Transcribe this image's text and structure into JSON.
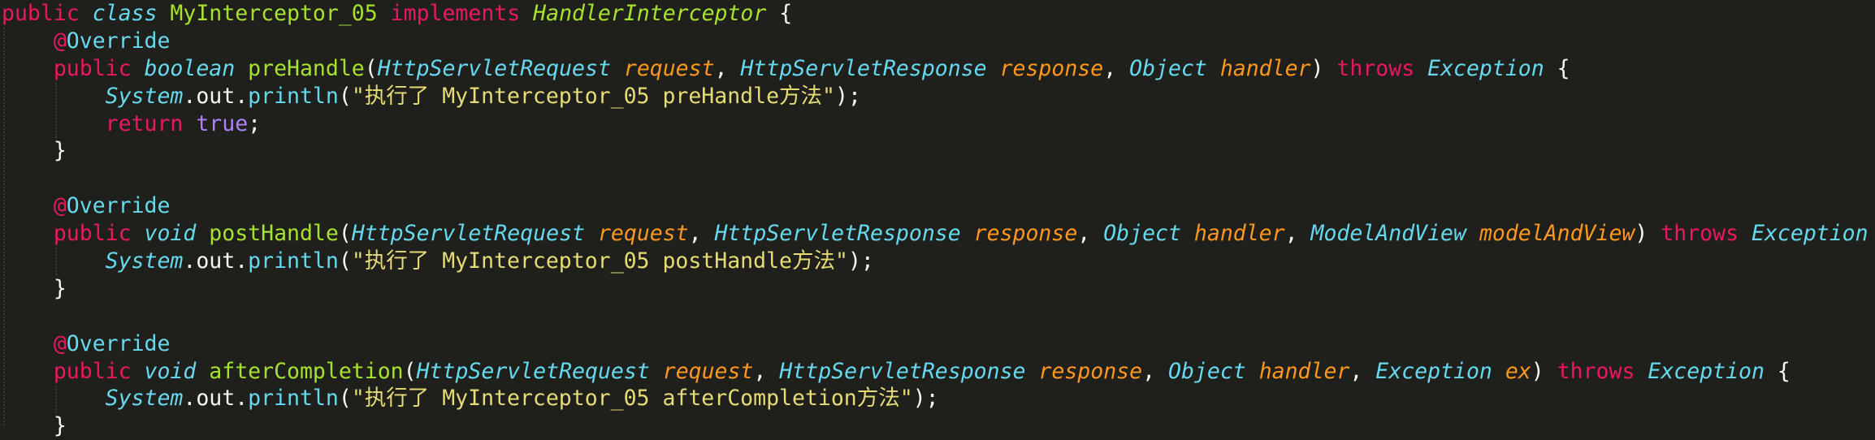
{
  "colors": {
    "background": "#1f1f1c",
    "keyword": "#e8195f",
    "type": "#66d9ef",
    "function": "#a6e22e",
    "parameter": "#fd971f",
    "string": "#e6db74",
    "constant": "#ae81ff",
    "plain": "#f8f8f2"
  },
  "lines": [
    [
      {
        "t": "public ",
        "k": "kw"
      },
      {
        "t": "class ",
        "k": "st"
      },
      {
        "t": "MyInterceptor_05 ",
        "k": "cl"
      },
      {
        "t": "implements ",
        "k": "kw"
      },
      {
        "t": "HandlerInterceptor",
        "k": "ic"
      },
      {
        "t": " {",
        "k": "pl"
      }
    ],
    [
      {
        "t": "    ",
        "k": "pl"
      },
      {
        "t": "@",
        "k": "an"
      },
      {
        "t": "Override",
        "k": "ann"
      }
    ],
    [
      {
        "t": "    ",
        "k": "pl"
      },
      {
        "t": "public ",
        "k": "kw"
      },
      {
        "t": "boolean ",
        "k": "st"
      },
      {
        "t": "preHandle",
        "k": "fn"
      },
      {
        "t": "(",
        "k": "pl"
      },
      {
        "t": "HttpServletRequest ",
        "k": "ty"
      },
      {
        "t": "request",
        "k": "pa"
      },
      {
        "t": ", ",
        "k": "pl"
      },
      {
        "t": "HttpServletResponse ",
        "k": "ty"
      },
      {
        "t": "response",
        "k": "pa"
      },
      {
        "t": ", ",
        "k": "pl"
      },
      {
        "t": "Object ",
        "k": "ty"
      },
      {
        "t": "handler",
        "k": "pa"
      },
      {
        "t": ") ",
        "k": "pl"
      },
      {
        "t": "throws ",
        "k": "kw"
      },
      {
        "t": "Exception",
        "k": "ty"
      },
      {
        "t": " {",
        "k": "pl"
      }
    ],
    [
      {
        "t": "        ",
        "k": "pl"
      },
      {
        "t": "System",
        "k": "sy"
      },
      {
        "t": ".out.",
        "k": "pl"
      },
      {
        "t": "println",
        "k": "me"
      },
      {
        "t": "(",
        "k": "pl"
      },
      {
        "t": "\"执行了 MyInterceptor_05 preHandle方法\"",
        "k": "str"
      },
      {
        "t": ");",
        "k": "pl"
      }
    ],
    [
      {
        "t": "        ",
        "k": "pl"
      },
      {
        "t": "return ",
        "k": "kw"
      },
      {
        "t": "true",
        "k": "num"
      },
      {
        "t": ";",
        "k": "pl"
      }
    ],
    [
      {
        "t": "    }",
        "k": "pl"
      }
    ],
    [],
    [
      {
        "t": "    ",
        "k": "pl"
      },
      {
        "t": "@",
        "k": "an"
      },
      {
        "t": "Override",
        "k": "ann"
      }
    ],
    [
      {
        "t": "    ",
        "k": "pl"
      },
      {
        "t": "public ",
        "k": "kw"
      },
      {
        "t": "void ",
        "k": "st"
      },
      {
        "t": "postHandle",
        "k": "fn"
      },
      {
        "t": "(",
        "k": "pl"
      },
      {
        "t": "HttpServletRequest ",
        "k": "ty"
      },
      {
        "t": "request",
        "k": "pa"
      },
      {
        "t": ", ",
        "k": "pl"
      },
      {
        "t": "HttpServletResponse ",
        "k": "ty"
      },
      {
        "t": "response",
        "k": "pa"
      },
      {
        "t": ", ",
        "k": "pl"
      },
      {
        "t": "Object ",
        "k": "ty"
      },
      {
        "t": "handler",
        "k": "pa"
      },
      {
        "t": ", ",
        "k": "pl"
      },
      {
        "t": "ModelAndView ",
        "k": "ty"
      },
      {
        "t": "modelAndView",
        "k": "pa"
      },
      {
        "t": ") ",
        "k": "pl"
      },
      {
        "t": "throws ",
        "k": "kw"
      },
      {
        "t": "Exception",
        "k": "ty"
      }
    ],
    [
      {
        "t": "        ",
        "k": "pl"
      },
      {
        "t": "System",
        "k": "sy"
      },
      {
        "t": ".out.",
        "k": "pl"
      },
      {
        "t": "println",
        "k": "me"
      },
      {
        "t": "(",
        "k": "pl"
      },
      {
        "t": "\"执行了 MyInterceptor_05 postHandle方法\"",
        "k": "str"
      },
      {
        "t": ");",
        "k": "pl"
      }
    ],
    [
      {
        "t": "    }",
        "k": "pl"
      }
    ],
    [],
    [
      {
        "t": "    ",
        "k": "pl"
      },
      {
        "t": "@",
        "k": "an"
      },
      {
        "t": "Override",
        "k": "ann"
      }
    ],
    [
      {
        "t": "    ",
        "k": "pl"
      },
      {
        "t": "public ",
        "k": "kw"
      },
      {
        "t": "void ",
        "k": "st"
      },
      {
        "t": "afterCompletion",
        "k": "fn"
      },
      {
        "t": "(",
        "k": "pl"
      },
      {
        "t": "HttpServletRequest ",
        "k": "ty"
      },
      {
        "t": "request",
        "k": "pa"
      },
      {
        "t": ", ",
        "k": "pl"
      },
      {
        "t": "HttpServletResponse ",
        "k": "ty"
      },
      {
        "t": "response",
        "k": "pa"
      },
      {
        "t": ", ",
        "k": "pl"
      },
      {
        "t": "Object ",
        "k": "ty"
      },
      {
        "t": "handler",
        "k": "pa"
      },
      {
        "t": ", ",
        "k": "pl"
      },
      {
        "t": "Exception ",
        "k": "ty"
      },
      {
        "t": "ex",
        "k": "pa"
      },
      {
        "t": ") ",
        "k": "pl"
      },
      {
        "t": "throws ",
        "k": "kw"
      },
      {
        "t": "Exception",
        "k": "ty"
      },
      {
        "t": " {",
        "k": "pl"
      }
    ],
    [
      {
        "t": "        ",
        "k": "pl"
      },
      {
        "t": "System",
        "k": "sy"
      },
      {
        "t": ".out.",
        "k": "pl"
      },
      {
        "t": "println",
        "k": "me"
      },
      {
        "t": "(",
        "k": "pl"
      },
      {
        "t": "\"执行了 MyInterceptor_05 afterCompletion方法\"",
        "k": "str"
      },
      {
        "t": ");",
        "k": "pl"
      }
    ],
    [
      {
        "t": "    }",
        "k": "pl"
      }
    ]
  ]
}
